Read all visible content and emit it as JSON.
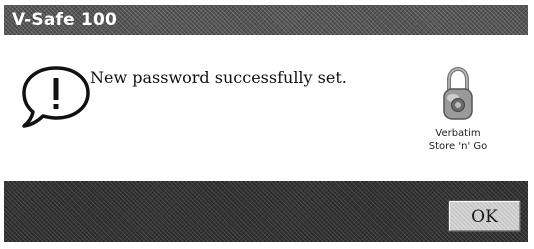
{
  "window": {
    "title": "V-Safe 100"
  },
  "message": {
    "text": "New password successfully set.",
    "icon": "info-icon"
  },
  "brand": {
    "icon": "padlock-icon",
    "line1": "Verbatim",
    "line2": "Store 'n' Go"
  },
  "buttons": {
    "ok_label": "OK"
  },
  "colors": {
    "titlebar": "#555555",
    "footer": "#333333",
    "button": "#d6d6d6"
  }
}
